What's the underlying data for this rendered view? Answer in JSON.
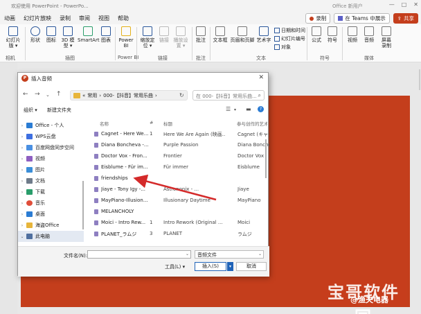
{
  "window": {
    "title": "欢迎使用 PowerPoint - PowerPo...",
    "account": "Office 新用户",
    "controls": [
      "—",
      "□",
      "✕"
    ]
  },
  "menu": {
    "items": [
      "动画",
      "幻灯片放映",
      "录制",
      "审阅",
      "视图",
      "帮助"
    ],
    "record_label": "录制",
    "teams_label": "在 Teams 中展示",
    "share_label": "共享"
  },
  "ribbon": {
    "buttons": {
      "slide_library": "相机",
      "reuse_slides": "幻灯片\n版 ▾",
      "shapes": "形状",
      "icons": "图标",
      "model_3d": "3D 模\n型 ▾",
      "smartart": "SmartArt",
      "chart": "图表",
      "powerbi": "Power\nBI",
      "action": "播放设\n置 ▾",
      "link": "链接",
      "zoom": "缩放定\n位 ▾",
      "comment": "批注",
      "textbox": "文本框",
      "header_footer": "页眉和页脚",
      "wordart": "艺术字",
      "equation": "公式",
      "symbol": "符号",
      "video": "视频",
      "audio": "音频",
      "screen_recording": "屏幕\n录制"
    },
    "small": {
      "datetime": "日期和时间",
      "slide_number": "幻灯片编号",
      "object": "对象"
    },
    "groups": {
      "camera": "相机",
      "illustrations": "插图",
      "powerbi": "Power BI",
      "links": "链接",
      "comments": "批注",
      "text": "文本",
      "symbols": "符号",
      "media": "媒体"
    }
  },
  "dialog": {
    "title": "插入音频",
    "breadcrumb": [
      "«",
      "常用",
      "›",
      "000-【抖音】常用乐曲",
      "›"
    ],
    "search_placeholder": "在 000-【抖音】常用乐曲...",
    "organize": "组织 ▾",
    "new_folder": "新建文件夹",
    "nav": [
      {
        "label": "Office - 个人",
        "color": "#2b7cd3"
      },
      {
        "label": "WPS云盘",
        "color": "#3e6fe0"
      },
      {
        "label": "百度网盘同步空间",
        "color": "#4a90e2"
      },
      {
        "label": "视频",
        "color": "#8e5fc1"
      },
      {
        "label": "图片",
        "color": "#3b8ed8"
      },
      {
        "label": "文档",
        "color": "#6f7b8a"
      },
      {
        "label": "下载",
        "color": "#2a9d6b"
      },
      {
        "label": "音乐",
        "color": "#e04e3a"
      },
      {
        "label": "桌面",
        "color": "#2b7cd3"
      },
      {
        "label": "海盗Office",
        "color": "#e7b53b"
      },
      {
        "label": "此电脑",
        "color": "#4f6f9f"
      }
    ],
    "columns": [
      "名称",
      "#",
      "标题",
      "参与创作的艺术家"
    ],
    "files": [
      {
        "name": "Cagnet - Here We...",
        "num": "1",
        "title": "Here We Are Again (映画...",
        "artist": "Cagnet (キャグネ..."
      },
      {
        "name": "Diana Boncheva -...",
        "num": "",
        "title": "Purple Passion",
        "artist": "Diana Boncheva"
      },
      {
        "name": "Doctor Vox - Fron...",
        "num": "",
        "title": "Frontier",
        "artist": "Doctor Vox"
      },
      {
        "name": "Eisblume - Für im...",
        "num": "",
        "title": "Für immer",
        "artist": "Eisblume"
      },
      {
        "name": "friendships",
        "num": "",
        "title": "",
        "artist": ""
      },
      {
        "name": "Jiaye - Tony Igy -...",
        "num": "",
        "title": "Astrononix - ...",
        "artist": "Jiaye"
      },
      {
        "name": "MayPiano-Illusion...",
        "num": "",
        "title": "Illusionary Daytime",
        "artist": "MayPiano"
      },
      {
        "name": "MELANCHOLY",
        "num": "",
        "title": "",
        "artist": ""
      },
      {
        "name": "Moici - Intro Rew...",
        "num": "1",
        "title": "Intro Rework (Original ...",
        "artist": "Moici"
      },
      {
        "name": "PLANET_ラムジ",
        "num": "3",
        "title": "PLANET",
        "artist": "ラムジ"
      }
    ],
    "filename_label": "文件名(N):",
    "filename_value": "",
    "filetype": "音频文件",
    "tools": "工具(L) ▾",
    "insert": "插入(S)",
    "cancel": "取消"
  },
  "watermark": {
    "text": "宝哥软件园",
    "sub": "@渔夫电器"
  },
  "colors": {
    "accent": "#c43e1c",
    "link_blue": "#2b579a",
    "dialog_primary": "#1f63b8",
    "arrow": "#d42a2a"
  }
}
